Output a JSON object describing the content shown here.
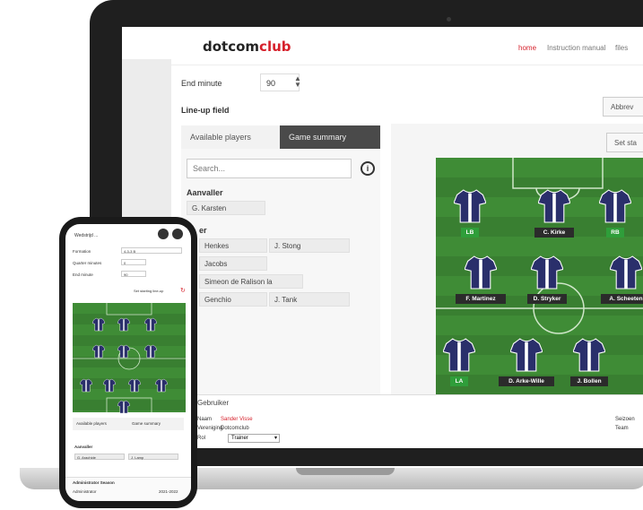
{
  "brand": {
    "part1": "dotcom",
    "part2": "club"
  },
  "nav": {
    "home": "home",
    "manual": "Instruction manual",
    "files": "files"
  },
  "form": {
    "end_minute_label": "End minute",
    "end_minute_value": "90"
  },
  "lineup": {
    "title": "Line-up field",
    "abbrev_button": "Abbrev",
    "set_button": "Set sta",
    "tabs": {
      "available": "Available players",
      "summary": "Game summary"
    },
    "search_placeholder": "Search...",
    "info": "i",
    "attacker_label": "Aanvaller",
    "attacker_player": "G. Karsten",
    "defender_label": "er",
    "players": [
      "Henkes",
      "J. Stong",
      "Jacobs",
      "Simeon de Ralison la Petriandos",
      "Genchio",
      "J. Tank"
    ]
  },
  "pitch_players": {
    "row1": [
      "LB",
      "C. Kirke",
      "RB"
    ],
    "row2": [
      "F. Martinez",
      "D. Stryker",
      "A. Scheeten"
    ],
    "row3": [
      "LA",
      "D. Arke-Wille",
      "J. Bollen"
    ]
  },
  "footer": {
    "title": "Gebruiker",
    "name_label": "Naam",
    "name_value": "Sander Visse",
    "club_label": "Vereniging",
    "club_value": "Dotcomclub",
    "role_label": "Rol",
    "role_value": "Trainer",
    "right1": "Seizoen",
    "right2": "Team"
  },
  "phone": {
    "title": "Wedstrijd ...",
    "formation_label": "Formation",
    "formation_value": "4-3-3 B",
    "quarters_label": "Quarter minutes",
    "quarters_value": "0",
    "end_label": "End minute",
    "end_value": "90",
    "set_button": "Set starting line-up",
    "tab_available": "Available players",
    "tab_summary": "Game summary",
    "attacker_label": "Aanvaller",
    "attacker1": "G. Arachide",
    "attacker2": "J. Lamp",
    "footer_title": "Administrator Season",
    "footer_left": "Administrator",
    "footer_right": "2021-2022"
  },
  "colors": {
    "brand_red": "#d6202b",
    "pitch_green": "#3f8c36",
    "shirt_navy": "#2a2f6b"
  }
}
